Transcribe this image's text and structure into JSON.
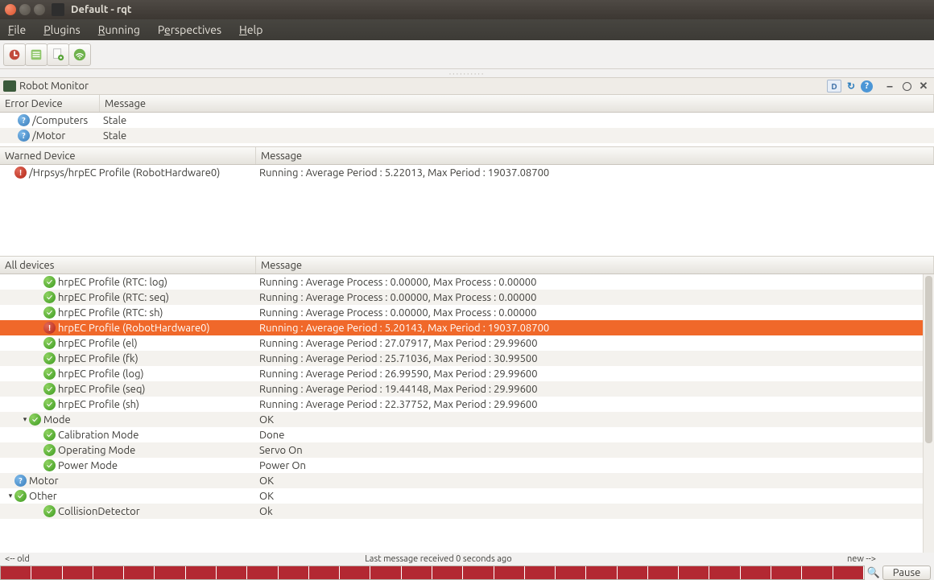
{
  "window": {
    "title": "Default - rqt"
  },
  "menus": {
    "file": "File",
    "plugins": "Plugins",
    "running": "Running",
    "perspectives": "Perspectives",
    "help": "Help"
  },
  "plugin_title": "Robot Monitor",
  "error_pane": {
    "col_device": "Error Device",
    "col_message": "Message",
    "rows": [
      {
        "device": "/Computers",
        "message": "Stale",
        "status": "stale"
      },
      {
        "device": "/Motor",
        "message": "Stale",
        "status": "stale"
      }
    ]
  },
  "warn_pane": {
    "col_device": "Warned Device",
    "col_message": "Message",
    "rows": [
      {
        "device": "/Hrpsys/hrpEC Profile (RobotHardware0)",
        "message": "Running : Average Period : 5.22013, Max Period : 19037.08700",
        "status": "warn"
      }
    ]
  },
  "all_pane": {
    "col_device": "All devices",
    "col_message": "Message",
    "rows": [
      {
        "indent": 2,
        "disclosure": "",
        "status": "ok",
        "device": "hrpEC Profile (RTC: log)",
        "message": "Running : Average Process : 0.00000, Max Process : 0.00000",
        "alt": false
      },
      {
        "indent": 2,
        "disclosure": "",
        "status": "ok",
        "device": "hrpEC Profile (RTC: seq)",
        "message": "Running : Average Process : 0.00000, Max Process : 0.00000",
        "alt": true
      },
      {
        "indent": 2,
        "disclosure": "",
        "status": "ok",
        "device": "hrpEC Profile (RTC: sh)",
        "message": "Running : Average Process : 0.00000, Max Process : 0.00000",
        "alt": false
      },
      {
        "indent": 2,
        "disclosure": "",
        "status": "warn",
        "device": "hrpEC Profile (RobotHardware0)",
        "message": "Running : Average Period : 5.20143, Max Period : 19037.08700",
        "sel": true
      },
      {
        "indent": 2,
        "disclosure": "",
        "status": "ok",
        "device": "hrpEC Profile (el)",
        "message": "Running : Average Period : 27.07917, Max Period : 29.99600",
        "alt": false
      },
      {
        "indent": 2,
        "disclosure": "",
        "status": "ok",
        "device": "hrpEC Profile (fk)",
        "message": "Running : Average Period : 25.71036, Max Period : 30.99500",
        "alt": true
      },
      {
        "indent": 2,
        "disclosure": "",
        "status": "ok",
        "device": "hrpEC Profile (log)",
        "message": "Running : Average Period : 26.99590, Max Period : 29.99600",
        "alt": false
      },
      {
        "indent": 2,
        "disclosure": "",
        "status": "ok",
        "device": "hrpEC Profile (seq)",
        "message": "Running : Average Period : 19.44148, Max Period : 29.99600",
        "alt": true
      },
      {
        "indent": 2,
        "disclosure": "",
        "status": "ok",
        "device": "hrpEC Profile (sh)",
        "message": "Running : Average Period : 22.37752, Max Period : 29.99600",
        "alt": false
      },
      {
        "indent": 1,
        "disclosure": "▾",
        "status": "ok",
        "device": "Mode",
        "message": "OK",
        "alt": true
      },
      {
        "indent": 2,
        "disclosure": "",
        "status": "ok",
        "device": "Calibration Mode",
        "message": "Done",
        "alt": false
      },
      {
        "indent": 2,
        "disclosure": "",
        "status": "ok",
        "device": "Operating Mode",
        "message": "Servo On",
        "alt": true
      },
      {
        "indent": 2,
        "disclosure": "",
        "status": "ok",
        "device": "Power Mode",
        "message": "Power On",
        "alt": false
      },
      {
        "indent": 0,
        "disclosure": "",
        "status": "stale",
        "device": "Motor",
        "message": "OK",
        "alt": true
      },
      {
        "indent": 0,
        "disclosure": "▾",
        "status": "ok",
        "device": "Other",
        "message": "OK",
        "alt": false
      },
      {
        "indent": 2,
        "disclosure": "",
        "status": "ok",
        "device": "CollisionDetector",
        "message": "Ok",
        "alt": true
      }
    ]
  },
  "timeline": {
    "old_label": "<-- old",
    "center_label": "Last message received 0 seconds ago",
    "new_label": "new -->",
    "pause_label": "Pause",
    "segments": 28
  }
}
